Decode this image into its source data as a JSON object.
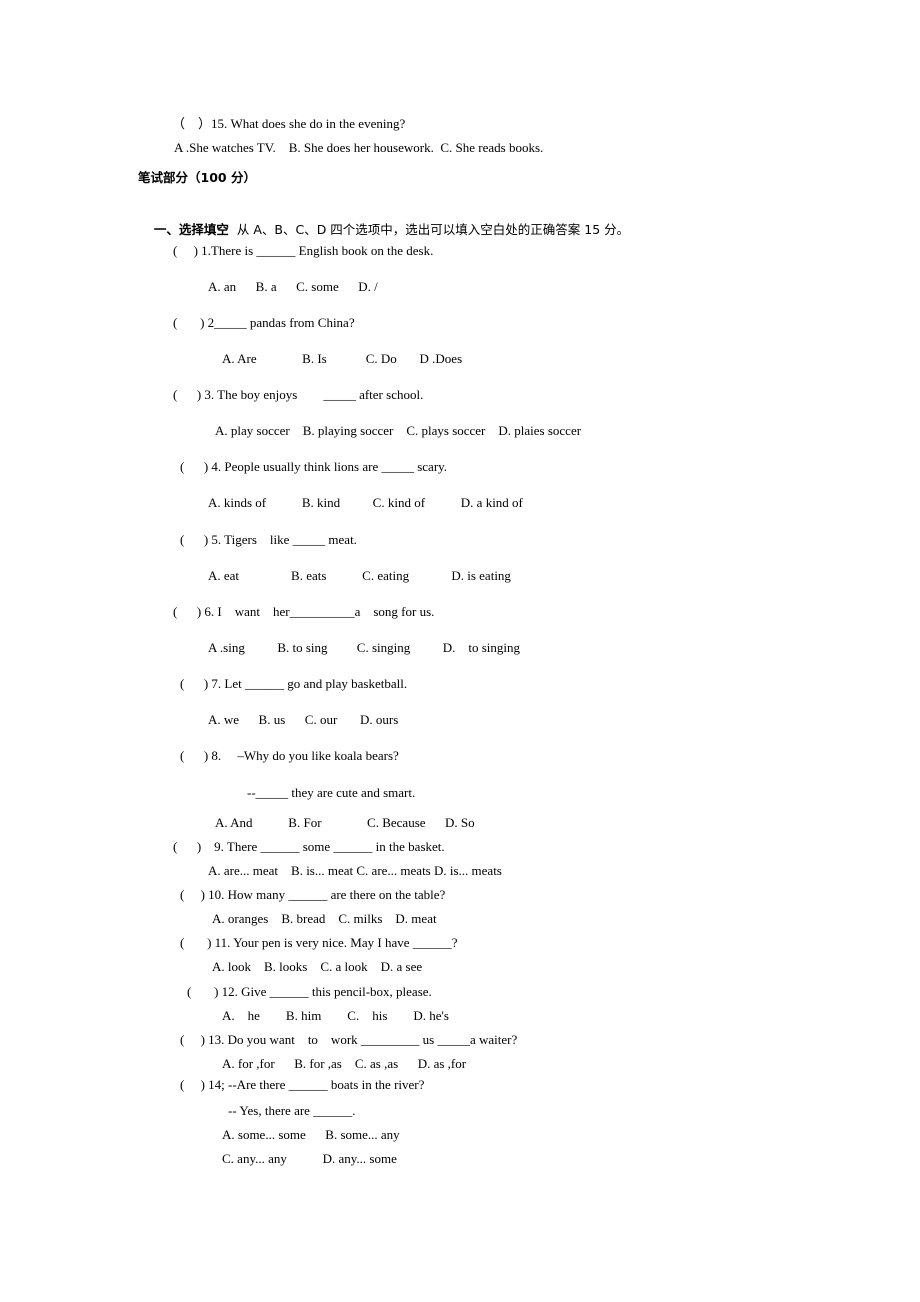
{
  "document": {
    "q15": {
      "stem": "（　）15. What does she do in the evening?",
      "options": "A .She watches TV.    B. She does her housework.  C. She reads books."
    },
    "section_title": "笔试部分（100 分）",
    "part1": {
      "heading": "一、选择填空",
      "instruction": "  从 A、B、C、D 四个选项中，选出可以填入空白处的正确答案 15 分。"
    },
    "questions": [
      {
        "stem": "(     ) 1.There is ______ English book on the desk.",
        "options": [
          "A. an      B. a      C. some      D. /"
        ]
      },
      {
        "stem": "(       ) 2_____ pandas from China?",
        "options": [
          "A. Are              B. Is            C. Do       D .Does"
        ]
      },
      {
        "stem": "(      ) 3. The boy enjoys        _____ after school.",
        "options": [
          "A. play soccer    B. playing soccer    C. plays soccer    D. plaies soccer"
        ]
      },
      {
        "stem": "(      ) 4. People usually think lions are _____ scary.",
        "options": [
          "A. kinds of           B. kind          C. kind of           D. a kind of"
        ]
      },
      {
        "stem": "(      ) 5. Tigers    like _____ meat.",
        "options": [
          "A. eat                B. eats           C. eating             D. is eating"
        ]
      },
      {
        "stem": "(      ) 6. I    want    her__________a    song for us.",
        "options": [
          "A .sing          B. to sing         C. singing          D.    to singing"
        ]
      },
      {
        "stem": "(      ) 7. Let ______ go and play basketball.",
        "options": [
          "A. we      B. us      C. our       D. ours"
        ]
      },
      {
        "stem": "(      ) 8.     –Why do you like koala bears?",
        "answer_line": "--_____ they are cute and smart.",
        "options": [
          "A. And           B. For              C. Because      D. So"
        ]
      },
      {
        "stem": "(      )    9. There ______ some ______ in the basket.",
        "options": [
          "A. are... meat    B. is... meat C. are... meats D. is... meats"
        ]
      },
      {
        "stem": "(     ) 10. How many ______ are there on the table?",
        "options": [
          "A. oranges    B. bread    C. milks    D. meat"
        ]
      },
      {
        "stem": "(       ) 11. Your pen is very nice. May I have ______?",
        "options": [
          "A. look    B. looks    C. a look    D. a see"
        ]
      },
      {
        "stem": "(       ) 12. Give ______ this pencil-box, please.",
        "options": [
          "A.    he        B. him        C.    his        D. he's"
        ]
      },
      {
        "stem": "(     ) 13. Do you want    to    work _________ us _____a waiter?",
        "options": [
          "A. for ,for      B. for ,as    C. as ,as      D. as ,for"
        ]
      },
      {
        "stem": "(     ) 14; --Are there ______ boats in the river?",
        "answer_line": "-- Yes, there are ______.",
        "options": [
          "A. some... some      B. some... any",
          "C. any... any           D. any... some"
        ]
      }
    ]
  }
}
